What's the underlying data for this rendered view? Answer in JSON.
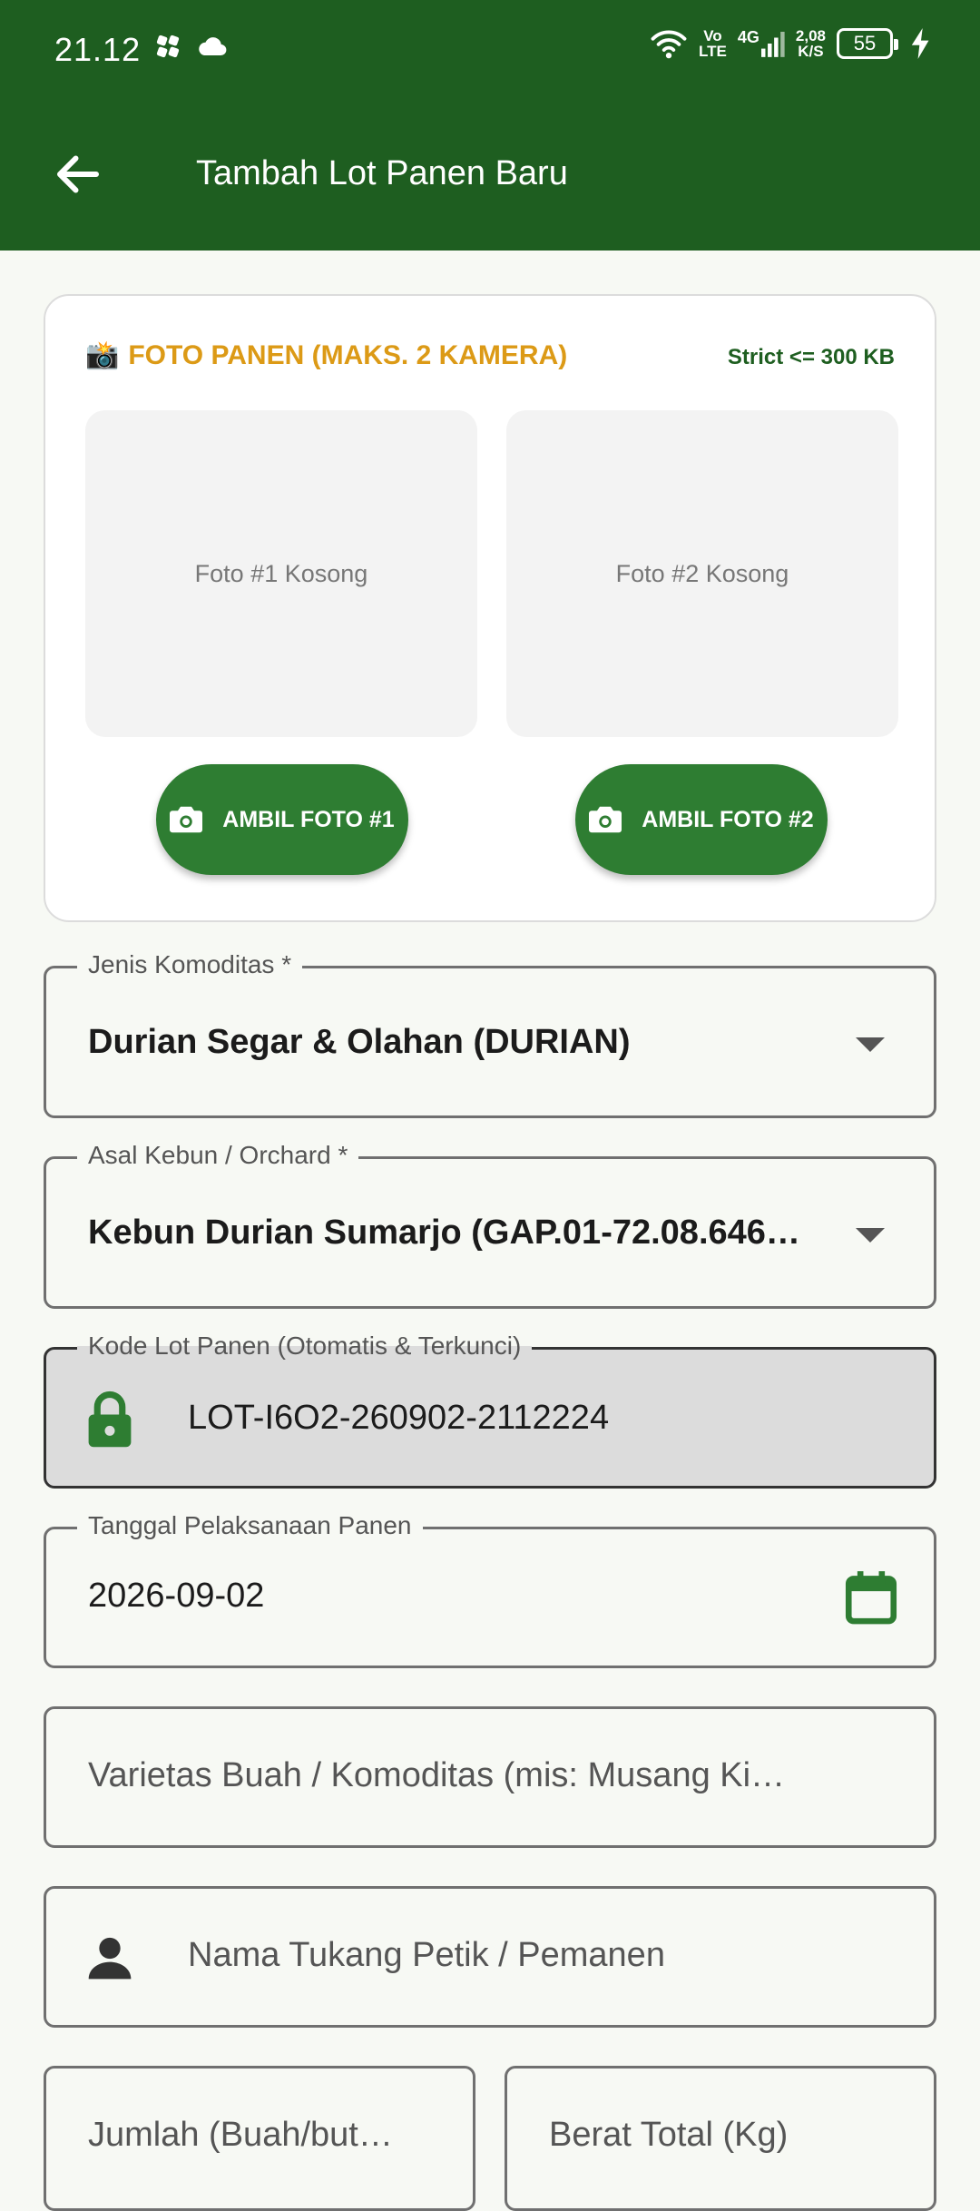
{
  "status_bar": {
    "time": "21.12",
    "volte_top": "Vo",
    "volte_bottom": "LTE",
    "network": "4G",
    "speed_value": "2,08",
    "speed_unit": "K/S",
    "battery": "55"
  },
  "app_bar": {
    "title": "Tambah Lot Panen Baru"
  },
  "photo_card": {
    "emoji": "📸",
    "title": "FOTO PANEN (MAKS. 2 KAMERA)",
    "note": "Strict <= 300 KB",
    "photo1_placeholder": "Foto #1 Kosong",
    "photo2_placeholder": "Foto #2 Kosong",
    "button1_label": "AMBIL FOTO #1",
    "button2_label": "AMBIL FOTO #2"
  },
  "form": {
    "commodity": {
      "label": "Jenis Komoditas *",
      "value": "Durian Segar & Olahan (DURIAN)"
    },
    "orchard": {
      "label": "Asal Kebun / Orchard *",
      "value": "Kebun Durian Sumarjo (GAP.01-72.08.646…"
    },
    "lot_code": {
      "label": "Kode Lot Panen (Otomatis & Terkunci)",
      "value": "LOT-I6O2-260902-2112224"
    },
    "harvest_date": {
      "label": "Tanggal Pelaksanaan Panen",
      "value": "2026-09-02"
    },
    "variety": {
      "placeholder": "Varietas Buah / Komoditas (mis: Musang Ki…"
    },
    "picker_name": {
      "placeholder": "Nama Tukang Petik / Pemanen"
    },
    "quantity": {
      "placeholder": "Jumlah (Buah/but…"
    },
    "total_weight": {
      "placeholder": "Berat Total (Kg)"
    }
  },
  "colors": {
    "primary": "#1e5e20",
    "button": "#2e7d32",
    "accent": "#dc9a16"
  }
}
